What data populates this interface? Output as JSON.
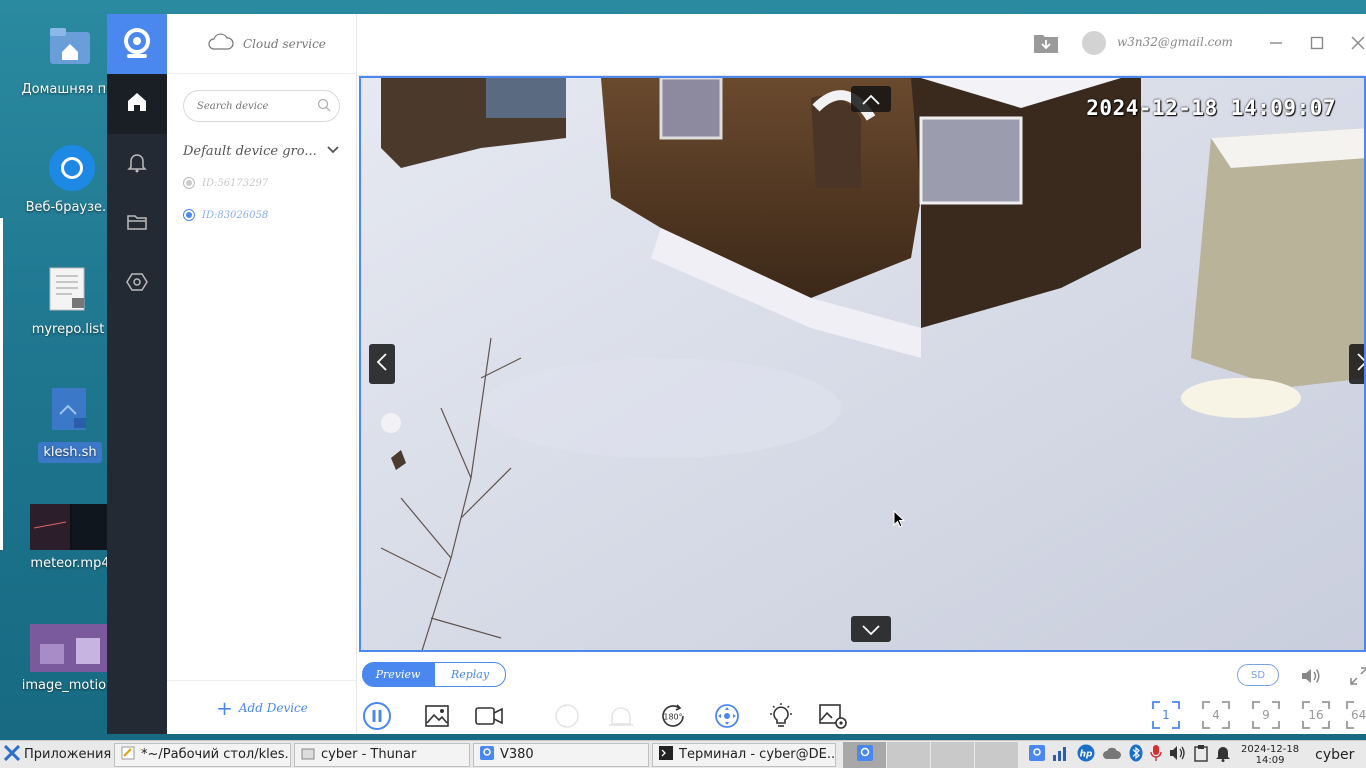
{
  "desktop": {
    "icons": [
      {
        "label": "Домашняя п...",
        "icon": "home-folder-icon"
      },
      {
        "label": "Веб-браузе...",
        "icon": "web-browser-icon"
      },
      {
        "label": "myrepo.list",
        "icon": "locked-text-file-icon"
      },
      {
        "label": "klesh.sh",
        "icon": "locked-script-file-icon"
      },
      {
        "label": "meteor.mp4",
        "icon": "video-thumbnail"
      },
      {
        "label": "image_motio...",
        "icon": "image-thumbnail"
      }
    ]
  },
  "app": {
    "cloud_service": "Cloud service",
    "search_placeholder": "Search device",
    "group_name": "Default device gro...",
    "devices": [
      {
        "id": "ID:56173297",
        "selected": false
      },
      {
        "id": "ID:83026058",
        "selected": true
      }
    ],
    "add_device": "Add Device",
    "email": "w3n32@gmail.com",
    "video_timestamp": "2024-12-18  14:09:07",
    "tabs": {
      "preview": "Preview",
      "replay": "Replay"
    },
    "quality": "SD",
    "splits": [
      "1",
      "4",
      "9",
      "16",
      "64"
    ],
    "accent": "#4a87ee"
  },
  "taskbar": {
    "start_label": "Приложения",
    "tasks": [
      {
        "label": "*~/Рабочий стол/kles...",
        "icon": "text-editor-icon"
      },
      {
        "label": "cyber - Thunar",
        "icon": "file-manager-icon"
      },
      {
        "label": "V380",
        "icon": "v380-app-icon"
      },
      {
        "label": "Терминал - cyber@DE...",
        "icon": "terminal-icon"
      }
    ],
    "date": "2024-12-18",
    "time": "14:09",
    "user": "cyber"
  }
}
